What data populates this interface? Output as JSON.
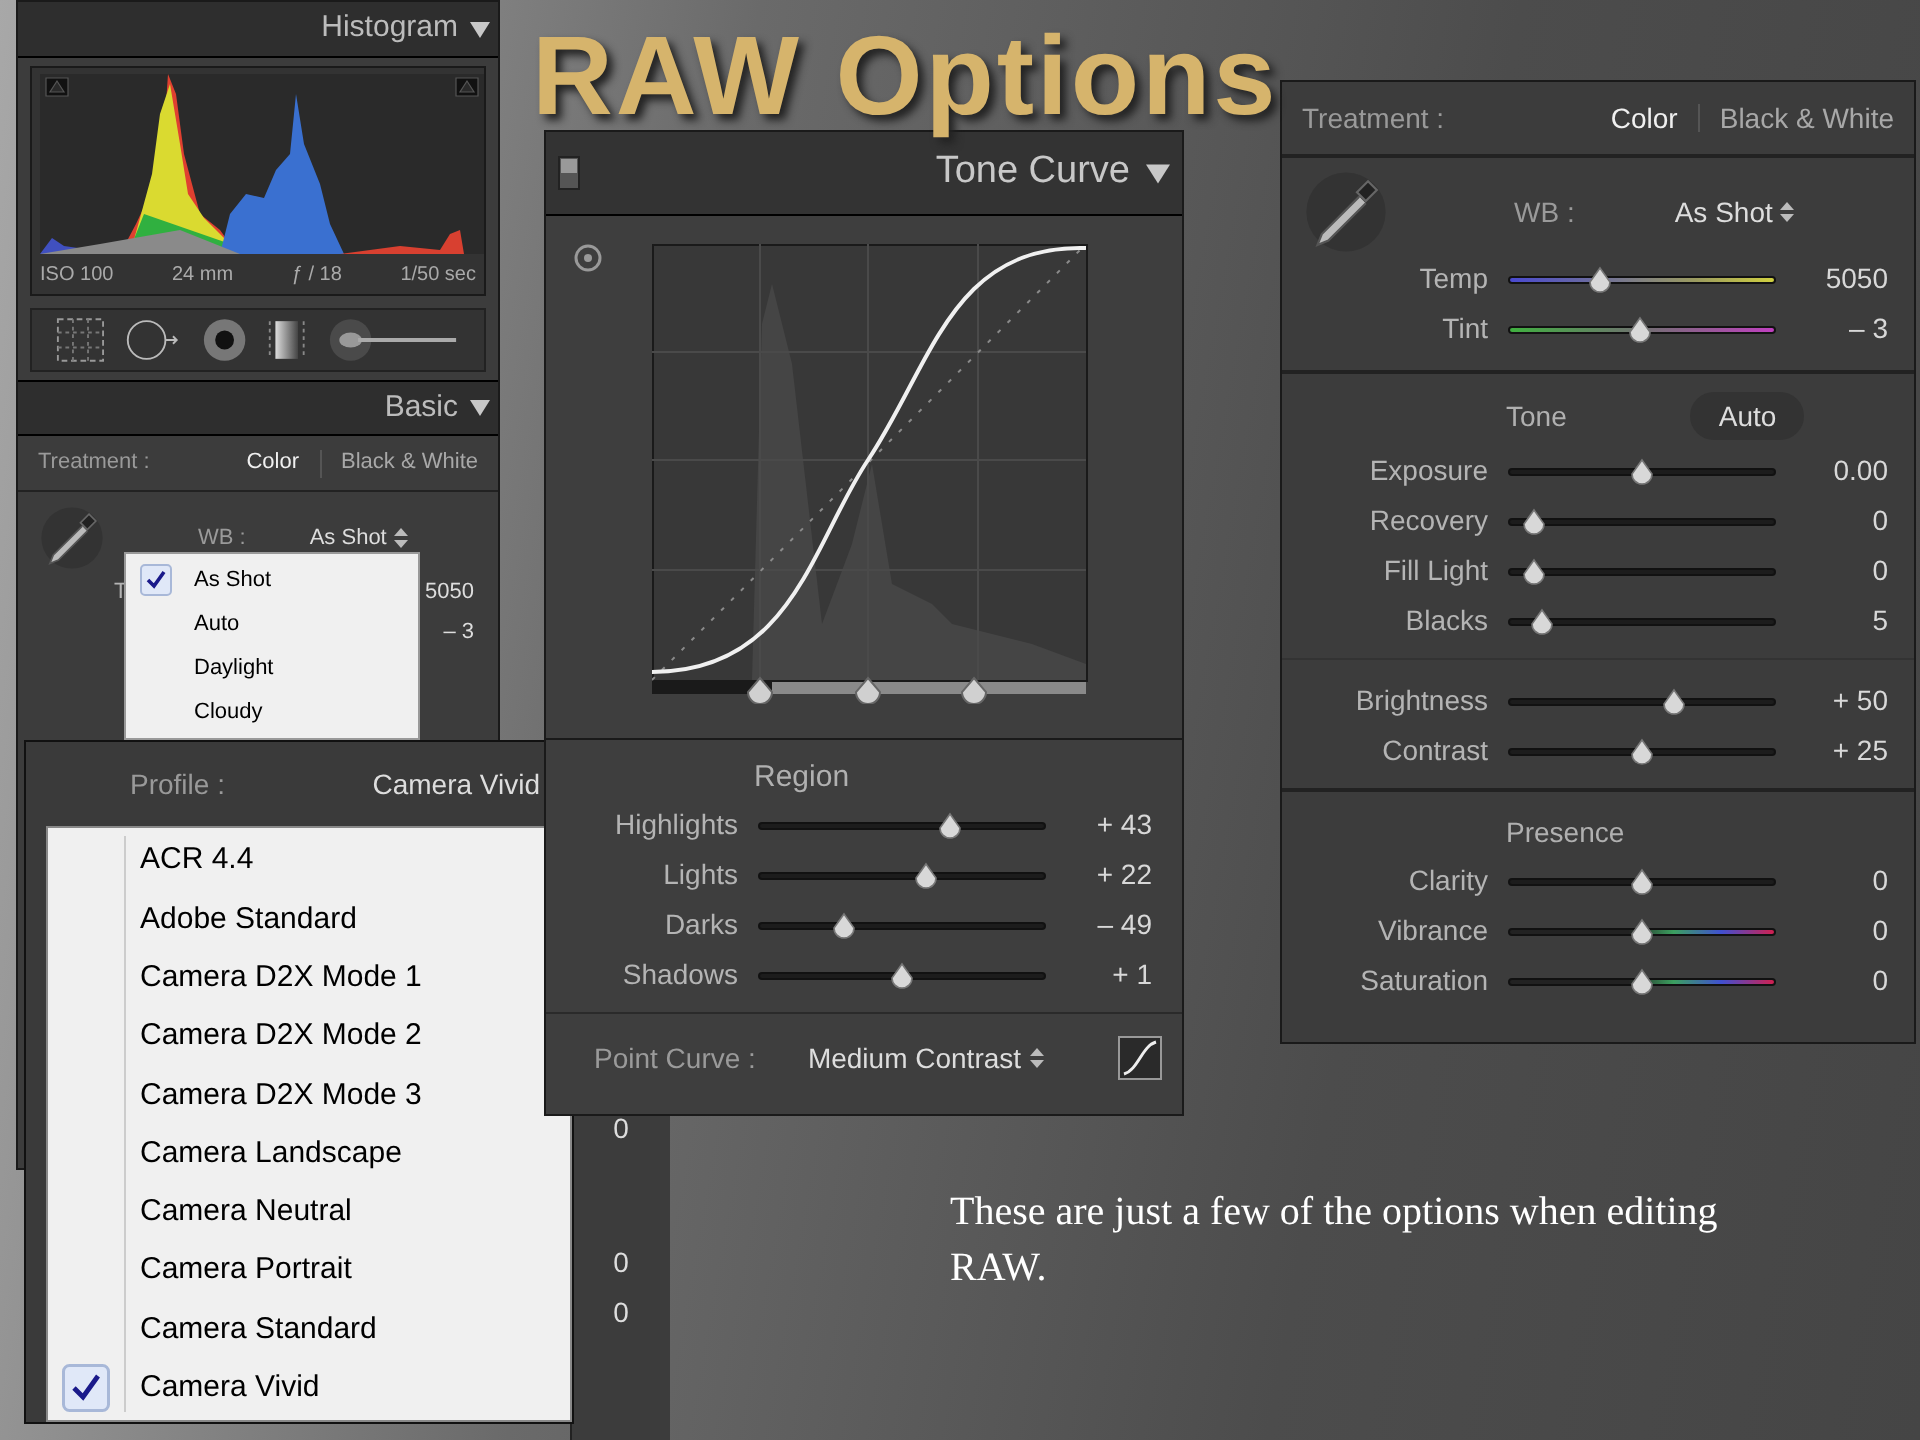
{
  "slide_title": "RAW Options",
  "caption": "These are just a few of the options when editing RAW.",
  "basic_panel": {
    "histogram_title": "Histogram",
    "exif": [
      "ISO 100",
      "24 mm",
      "ƒ / 18",
      "1/50 sec"
    ],
    "basic_title": "Basic",
    "treatment_label": "Treatment :",
    "treatment_options": [
      {
        "label": "Color",
        "selected": true
      },
      {
        "label": "Black & White",
        "selected": false
      }
    ],
    "wb_label": "WB :",
    "wb_value": "As Shot",
    "temp_fragment": "T",
    "temp_value": "5050",
    "tint_value": "– 3"
  },
  "wb_menu": [
    {
      "label": "As Shot",
      "selected": true
    },
    {
      "label": "Auto",
      "selected": false
    },
    {
      "label": "Daylight",
      "selected": false
    },
    {
      "label": "Cloudy",
      "selected": false
    }
  ],
  "profile_panel": {
    "label": "Profile :",
    "value": "Camera Vivid",
    "options": [
      {
        "label": "ACR 4.4",
        "selected": false
      },
      {
        "label": "Adobe Standard",
        "selected": false
      },
      {
        "label": "Camera D2X Mode 1",
        "selected": false
      },
      {
        "label": "Camera D2X Mode 2",
        "selected": false
      },
      {
        "label": "Camera D2X Mode 3",
        "selected": false
      },
      {
        "label": "Camera Landscape",
        "selected": false
      },
      {
        "label": "Camera Neutral",
        "selected": false
      },
      {
        "label": "Camera Portrait",
        "selected": false
      },
      {
        "label": "Camera Standard",
        "selected": false
      },
      {
        "label": "Camera Vivid",
        "selected": true
      }
    ]
  },
  "hidden_panel_values": [
    "0",
    "0",
    "0"
  ],
  "tone_curve": {
    "title": "Tone Curve",
    "region_title": "Region",
    "sliders": [
      {
        "label": "Highlights",
        "value": "+ 43",
        "level": 0.68,
        "kind": "plain"
      },
      {
        "label": "Lights",
        "value": "+ 22",
        "level": 0.59,
        "kind": "plain"
      },
      {
        "label": "Darks",
        "value": "– 49",
        "level": 0.28,
        "kind": "plain"
      },
      {
        "label": "Shadows",
        "value": "+ 1",
        "level": 0.5,
        "kind": "plain"
      }
    ],
    "point_curve_label": "Point Curve :",
    "point_curve_value": "Medium Contrast"
  },
  "right_panel": {
    "treatment_label": "Treatment :",
    "treatment_options": [
      {
        "label": "Color",
        "selected": true
      },
      {
        "label": "Black & White",
        "selected": false
      }
    ],
    "wb_label": "WB :",
    "wb_value": "As Shot",
    "wb_sliders": [
      {
        "label": "Temp",
        "value": "5050",
        "level": 0.33,
        "kind": "temp"
      },
      {
        "label": "Tint",
        "value": "– 3",
        "level": 0.49,
        "kind": "tint"
      }
    ],
    "tone_title": "Tone",
    "auto_button": "Auto",
    "tone_sliders": [
      {
        "label": "Exposure",
        "value": "0.00",
        "level": 0.5,
        "kind": "plain"
      },
      {
        "label": "Recovery",
        "value": "0",
        "level": 0.06,
        "kind": "plain"
      },
      {
        "label": "Fill Light",
        "value": "0",
        "level": 0.06,
        "kind": "plain"
      },
      {
        "label": "Blacks",
        "value": "5",
        "level": 0.09,
        "kind": "plain"
      }
    ],
    "bright_sliders": [
      {
        "label": "Brightness",
        "value": "+ 50",
        "level": 0.63,
        "kind": "plain"
      },
      {
        "label": "Contrast",
        "value": "+ 25",
        "level": 0.5,
        "kind": "plain"
      }
    ],
    "presence_title": "Presence",
    "presence_sliders": [
      {
        "label": "Clarity",
        "value": "0",
        "level": 0.5,
        "kind": "plain"
      },
      {
        "label": "Vibrance",
        "value": "0",
        "level": 0.5,
        "kind": "spectrum"
      },
      {
        "label": "Saturation",
        "value": "0",
        "level": 0.5,
        "kind": "spectrum"
      }
    ]
  }
}
